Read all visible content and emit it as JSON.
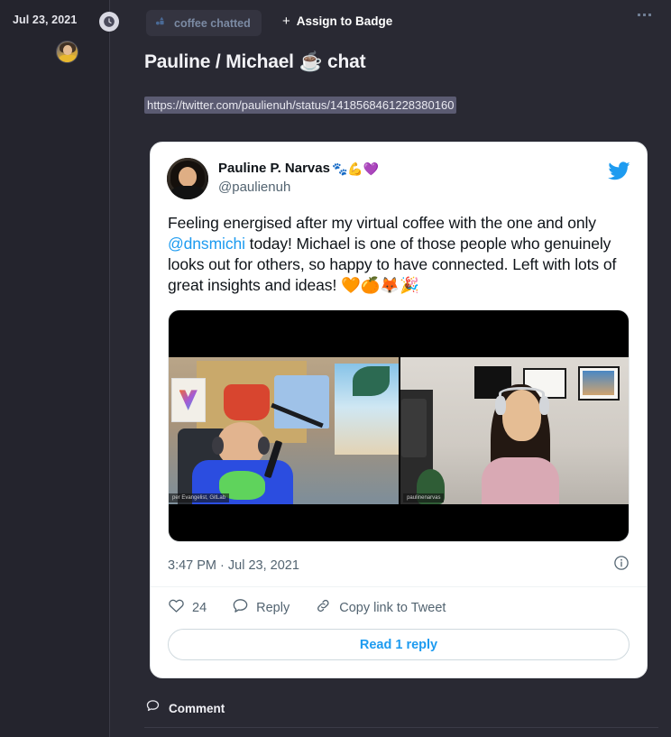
{
  "timeline": {
    "date": "Jul 23, 2021",
    "clock_icon": "clock-icon",
    "avatar_icon": "user-avatar"
  },
  "header": {
    "badge_chip": {
      "label": "coffee chatted",
      "icon": "badge-shapes-icon"
    },
    "assign_to_badge": {
      "plus": "+",
      "label": "Assign to Badge"
    },
    "overflow_menu_icon": "ellipsis-icon"
  },
  "entry": {
    "title": "Pauline / Michael ☕ chat",
    "url": "https://twitter.com/paulienuh/status/1418568461228380160"
  },
  "tweet": {
    "author_name": "Pauline P. Narvas",
    "author_emojis": "🐾💪💜",
    "handle": "@paulienuh",
    "logo_icon": "twitter-bird-icon",
    "body_part1": "Feeling energised after my virtual coffee with the one and only ",
    "body_mention": "@dnsmichi",
    "body_part2": " today! Michael is one of those people who genuinely looks out for others, so happy to have connected. Left with lots of great insights and ideas! 🧡🍊🦊🎉",
    "media": {
      "type": "video-call-screenshot",
      "left_participant_label": "per Evangelist, GitLab",
      "right_participant_label": "paulinenarvas"
    },
    "timestamp": "3:47 PM · Jul 23, 2021",
    "info_icon": "info-circle-icon",
    "actions": [
      {
        "icon": "heart-icon",
        "label": "24"
      },
      {
        "icon": "reply-bubble-icon",
        "label": "Reply"
      },
      {
        "icon": "link-chain-icon",
        "label": "Copy link to Tweet"
      }
    ],
    "read_replies_label": "Read 1 reply"
  },
  "footer": {
    "comment_label": "Comment",
    "comment_icon": "speech-bubble-icon"
  },
  "colors": {
    "page_bg": "#292933",
    "rail_bg": "#24242d",
    "chip_bg": "#343440",
    "chip_text": "#7b8aa3",
    "card_bg": "#ffffff",
    "twitter_blue": "#1d9bf0",
    "muted_text": "#536471",
    "selection_bg": "#5b5b72"
  }
}
